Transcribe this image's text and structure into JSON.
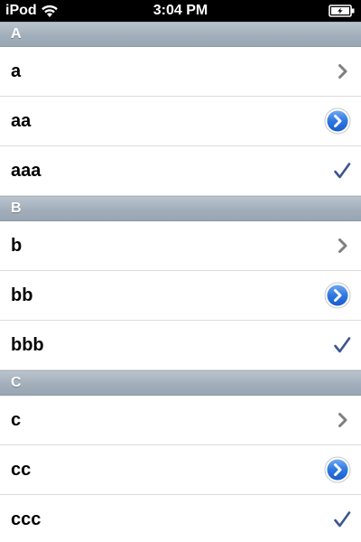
{
  "status_bar": {
    "carrier": "iPod",
    "time": "3:04 PM",
    "wifi_icon": "wifi-icon",
    "battery_icon": "battery-charging-icon"
  },
  "sections": [
    {
      "header": "A",
      "rows": [
        {
          "label": "a",
          "accessory": "disclosure-indicator"
        },
        {
          "label": "aa",
          "accessory": "detail-disclosure-button"
        },
        {
          "label": "aaa",
          "accessory": "checkmark"
        }
      ]
    },
    {
      "header": "B",
      "rows": [
        {
          "label": "b",
          "accessory": "disclosure-indicator"
        },
        {
          "label": "bb",
          "accessory": "detail-disclosure-button"
        },
        {
          "label": "bbb",
          "accessory": "checkmark"
        }
      ]
    },
    {
      "header": "C",
      "rows": [
        {
          "label": "c",
          "accessory": "disclosure-indicator"
        },
        {
          "label": "cc",
          "accessory": "detail-disclosure-button"
        },
        {
          "label": "ccc",
          "accessory": "checkmark"
        }
      ]
    }
  ],
  "colors": {
    "status_bar_bg": "#000000",
    "section_header_bg": "#a2afbb",
    "checkmark": "#3c568c",
    "detail_button_blue": "#1a64d6",
    "chevron_gray": "#7f7f7f"
  }
}
